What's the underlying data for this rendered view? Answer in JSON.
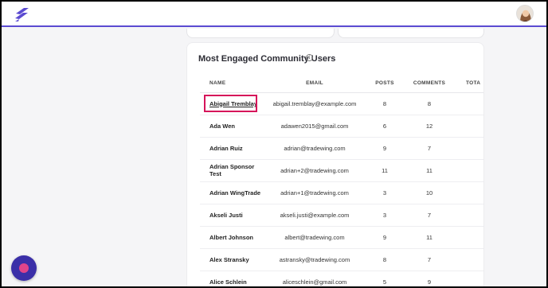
{
  "topbar": {
    "accent": "#5b4bd1"
  },
  "card": {
    "title": "Most Engaged Community Users",
    "info_glyph": "i"
  },
  "table": {
    "headers": {
      "name": "NAME",
      "email": "EMAIL",
      "posts": "POSTS",
      "comments": "COMMENTS",
      "total": "TOTA"
    },
    "rows": [
      {
        "name": "Abigail Tremblay",
        "email": "abigail.tremblay@example.com",
        "posts": "8",
        "comments": "8"
      },
      {
        "name": "Ada Wen",
        "email": "adawen2015@gmail.com",
        "posts": "6",
        "comments": "12"
      },
      {
        "name": "Adrian Ruiz",
        "email": "adrian@tradewing.com",
        "posts": "9",
        "comments": "7"
      },
      {
        "name": "Adrian Sponsor Test",
        "email": "adrian+2@tradewing.com",
        "posts": "11",
        "comments": "11"
      },
      {
        "name": "Adrian WingTrade",
        "email": "adrian+1@tradewing.com",
        "posts": "3",
        "comments": "10"
      },
      {
        "name": "Akseli Justi",
        "email": "akseli.justi@example.com",
        "posts": "3",
        "comments": "7"
      },
      {
        "name": "Albert Johnson",
        "email": "albert@tradewing.com",
        "posts": "9",
        "comments": "11"
      },
      {
        "name": "Alex Stransky",
        "email": "astransky@tradewing.com",
        "posts": "8",
        "comments": "7"
      },
      {
        "name": "Alice Schlein",
        "email": "aliceschlein@gmail.com",
        "posts": "5",
        "comments": "9"
      }
    ]
  },
  "colors": {
    "highlight": "#d6145a",
    "fab": "#3b2fa8",
    "fab_dot": "#e0448a"
  }
}
